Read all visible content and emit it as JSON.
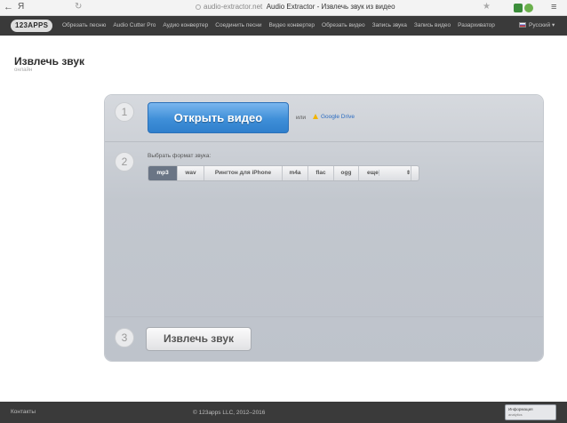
{
  "browser": {
    "back_glyph": "←",
    "yandex_glyph": "Я",
    "reload_glyph": "↻",
    "url_domain": "audio-extractor.net",
    "page_title": "Audio Extractor - Извлечь звук из видео",
    "star_glyph": "★",
    "menu_glyph": "≡"
  },
  "nav": {
    "logo": "123APPS",
    "links": [
      "Обрезать песню",
      "Audio Cutter Pro",
      "Аудио конвертер",
      "Соединить песни",
      "Видео конвертер",
      "Обрезать видео",
      "Запись звука",
      "Запись видео",
      "Разархиватор"
    ],
    "language": "Русский",
    "language_caret": "▾"
  },
  "page": {
    "title": "Извлечь звук",
    "subtitle": "онлайн"
  },
  "steps": {
    "step1_num": "1",
    "step2_num": "2",
    "step3_num": "3",
    "open_button": "Открыть видео",
    "or_text": "или",
    "google_drive": "Google Drive",
    "format_label": "Выбрать формат звука:",
    "formats": [
      "mp3",
      "wav",
      "Рингтон для iPhone",
      "m4a",
      "flac",
      "ogg"
    ],
    "selected_format": "mp3",
    "more_label": "еще",
    "more_arrow": "⇕",
    "extract_button": "Извлечь звук"
  },
  "footer": {
    "contacts": "Контакты",
    "copyright": "© 123apps LLC, 2012–2016",
    "badge_line1": "Информация",
    "badge_line2": "analytics"
  },
  "colors": {
    "nav_bg": "#3a3a3a",
    "open_button": "#3f8fd8",
    "selected_format": "#6a7585"
  }
}
